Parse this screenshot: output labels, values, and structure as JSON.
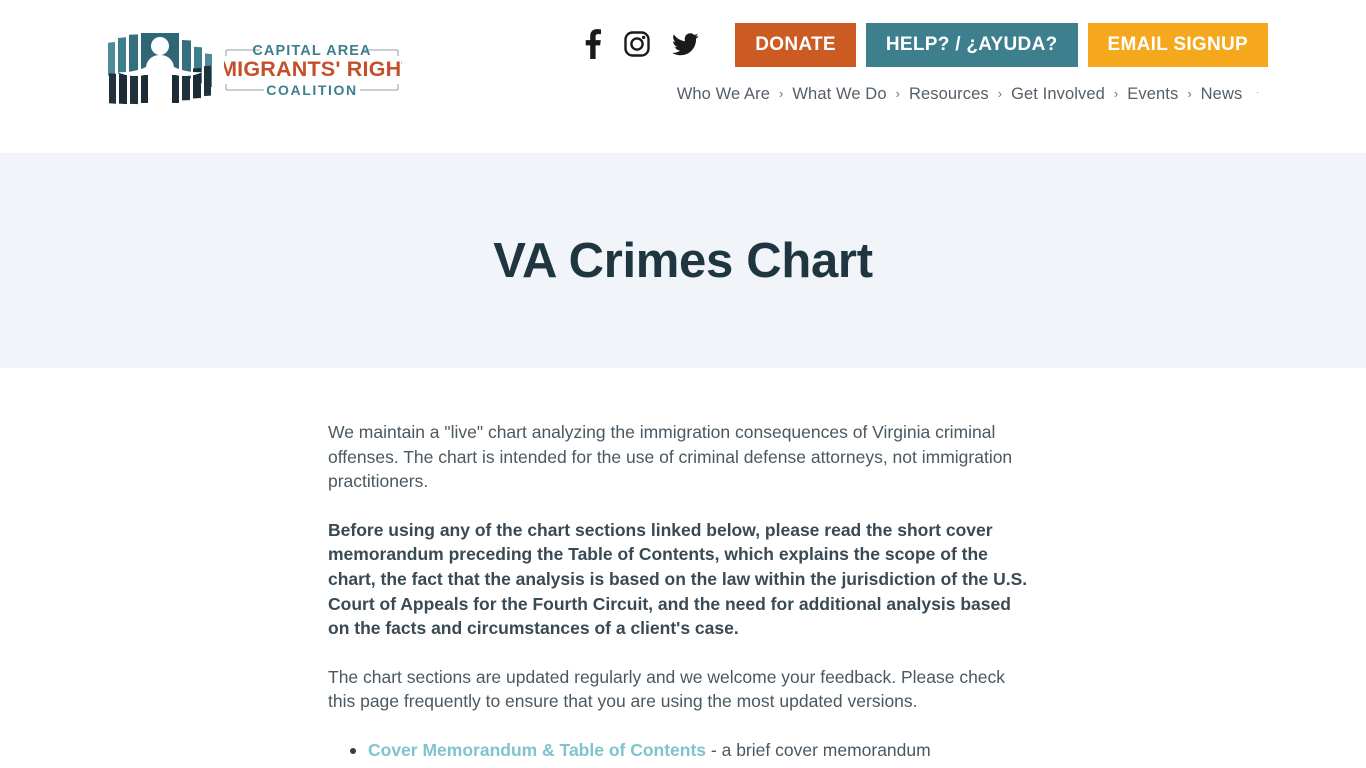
{
  "header": {
    "logo": {
      "name": "capital-area-immigrants-rights-coalition-logo",
      "line1": "CAPITAL AREA",
      "line2": "IMMIGRANTS' RIGHTS",
      "line3": "COALITION",
      "teal": "#3d7f8c",
      "orange": "#c4502a",
      "dark": "#22323d"
    },
    "social": [
      {
        "name": "facebook-icon",
        "label": "Facebook"
      },
      {
        "name": "instagram-icon",
        "label": "Instagram"
      },
      {
        "name": "twitter-icon",
        "label": "Twitter"
      }
    ],
    "buttons": {
      "donate": "DONATE",
      "help": "HELP? / ¿AYUDA?",
      "email_signup": "EMAIL SIGNUP",
      "donate_color": "#cc5a23",
      "help_color": "#3d7f8c",
      "email_color": "#f5a81c"
    },
    "nav": {
      "items": [
        "Who We Are",
        "What We Do",
        "Resources",
        "Get Involved",
        "Events",
        "News"
      ],
      "separator": "›",
      "trailing_separator": "·"
    }
  },
  "hero": {
    "title": "VA Crimes Chart",
    "background": "#f1f4f9"
  },
  "main": {
    "paragraph1": "We maintain a \"live\" chart analyzing the immigration consequences of Virginia criminal offenses. The chart is intended for the use of criminal defense attorneys, not immigration practitioners.",
    "paragraph2": "Before using any of the chart sections linked below, please read the short cover memorandum preceding the Table of Contents, which explains the scope of the chart, the fact that the analysis is based on the law within the jurisdiction of the U.S. Court of Appeals for the Fourth Circuit, and the need for additional analysis based on the facts and circumstances of a client's case.",
    "paragraph3": "The chart sections are updated regularly and we welcome your feedback. Please check this page frequently to ensure that you are using the most updated versions.",
    "list": [
      {
        "link_text": "Cover Memorandum & Table of Contents",
        "description": " - a brief cover memorandum"
      }
    ],
    "link_color": "#7fc4cc"
  }
}
